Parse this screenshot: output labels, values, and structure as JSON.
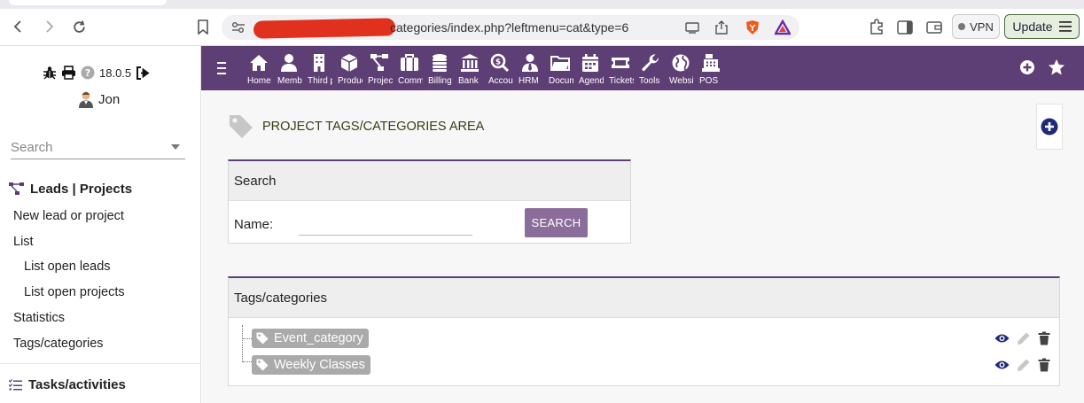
{
  "browser": {
    "url": "categories/index.php?leftmenu=cat&type=6",
    "vpn_label": "VPN",
    "update_label": "Update"
  },
  "sidebar": {
    "version": "18.0.5",
    "user": "Jon",
    "search_placeholder": "Search",
    "section1": "Leads | Projects",
    "items": [
      {
        "label": "New lead or project"
      },
      {
        "label": "List"
      },
      {
        "label": "List open leads"
      },
      {
        "label": "List open projects"
      },
      {
        "label": "Statistics"
      },
      {
        "label": "Tags/categories"
      }
    ],
    "section2": "Tasks/activities"
  },
  "topnav": {
    "items": [
      {
        "label": "Home",
        "icon": "home-icon"
      },
      {
        "label": "Members",
        "icon": "user-icon"
      },
      {
        "label": "Third parties",
        "icon": "building-icon"
      },
      {
        "label": "Products",
        "icon": "cube-icon"
      },
      {
        "label": "Projects",
        "icon": "project-icon"
      },
      {
        "label": "Commerce",
        "icon": "briefcase-icon"
      },
      {
        "label": "Billing",
        "icon": "coins-icon"
      },
      {
        "label": "Bank",
        "icon": "bank-icon"
      },
      {
        "label": "Accounting",
        "icon": "search-dollar-icon"
      },
      {
        "label": "HRM",
        "icon": "user-tie-icon"
      },
      {
        "label": "Documents",
        "icon": "folder-icon"
      },
      {
        "label": "Agenda",
        "icon": "calendar-icon"
      },
      {
        "label": "Tickets",
        "icon": "ticket-icon"
      },
      {
        "label": "Tools",
        "icon": "wrench-icon"
      },
      {
        "label": "Website",
        "icon": "globe-icon"
      },
      {
        "label": "POS",
        "icon": "cash-register-icon"
      }
    ]
  },
  "main": {
    "title": "PROJECT TAGS/CATEGORIES AREA",
    "search_panel": {
      "title": "Search",
      "name_label": "Name:",
      "name_value": "",
      "button": "SEARCH"
    },
    "tags_panel": {
      "title": "Tags/categories",
      "tags": [
        {
          "label": "Event_category"
        },
        {
          "label": "Weekly Classes"
        }
      ]
    }
  },
  "colors": {
    "nav_purple": "#5e3f75",
    "button_purple": "#8b6d9b",
    "tag_gray": "#aaaaaa",
    "icon_navy": "#1e2a78"
  }
}
